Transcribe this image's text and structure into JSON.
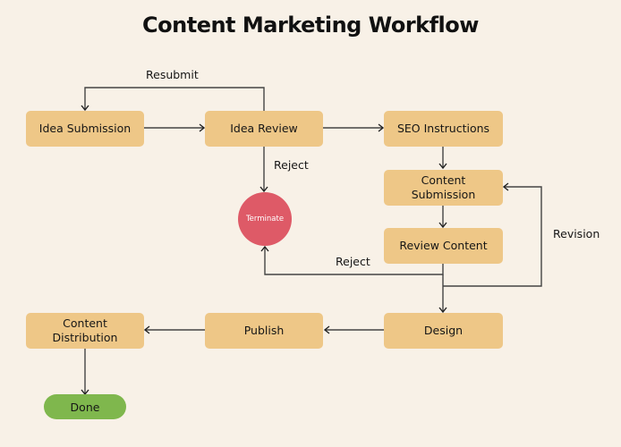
{
  "title": "Content Marketing Workflow",
  "colors": {
    "background": "#f8f1e7",
    "process_node": "#eec787",
    "terminate_node": "#de5a67",
    "done_node": "#7fb74d",
    "edge": "#333333"
  },
  "nodes": {
    "idea_submission": "Idea Submission",
    "idea_review": "Idea Review",
    "seo_instructions": "SEO Instructions",
    "content_submission": "Content\nSubmission",
    "review_content": "Review Content",
    "design": "Design",
    "publish": "Publish",
    "content_distribution": "Content\nDistribution",
    "terminate": "Terminate",
    "done": "Done"
  },
  "edge_labels": {
    "resubmit": "Resubmit",
    "reject_idea": "Reject",
    "reject_content": "Reject",
    "revision": "Revision"
  },
  "edges": [
    {
      "from": "Idea Submission",
      "to": "Idea Review"
    },
    {
      "from": "Idea Review",
      "to": "Idea Submission",
      "label": "Resubmit"
    },
    {
      "from": "Idea Review",
      "to": "SEO Instructions"
    },
    {
      "from": "Idea Review",
      "to": "Terminate",
      "label": "Reject"
    },
    {
      "from": "SEO Instructions",
      "to": "Content Submission"
    },
    {
      "from": "Content Submission",
      "to": "Review Content"
    },
    {
      "from": "Review Content",
      "to": "Content Submission",
      "label": "Revision"
    },
    {
      "from": "Review Content",
      "to": "Terminate",
      "label": "Reject"
    },
    {
      "from": "Review Content",
      "to": "Design"
    },
    {
      "from": "Design",
      "to": "Publish"
    },
    {
      "from": "Publish",
      "to": "Content Distribution"
    },
    {
      "from": "Content Distribution",
      "to": "Done"
    }
  ]
}
